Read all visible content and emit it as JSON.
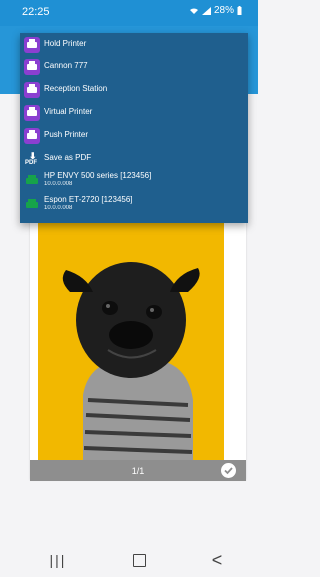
{
  "status_bar": {
    "time": "22:25",
    "battery": "28%",
    "icons": [
      "wifi-icon",
      "signal-icon",
      "battery-icon"
    ]
  },
  "menu": {
    "items": [
      {
        "label": "Hold Printer",
        "icon": "printer-icon"
      },
      {
        "label": "Cannon 777",
        "icon": "printer-icon"
      },
      {
        "label": "Reception Station",
        "icon": "printer-icon"
      },
      {
        "label": "Virtual Printer",
        "icon": "printer-icon"
      },
      {
        "label": "Push Printer",
        "icon": "printer-icon"
      },
      {
        "label": "Save as PDF",
        "icon": "pdf-download-icon"
      },
      {
        "label": "HP ENVY 500 series [123456]",
        "sub": "10.0.0.008",
        "icon": "printer-icon-green"
      },
      {
        "label": "Espon ET-2720 [123456]",
        "sub": "10.0.0.008",
        "icon": "printer-icon-green"
      }
    ]
  },
  "preview": {
    "page_count": "1/1"
  },
  "nav": {
    "recents": "|||",
    "back": "<"
  }
}
